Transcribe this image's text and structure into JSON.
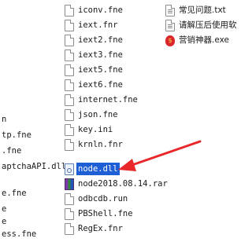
{
  "left_column": {
    "items": [
      {
        "label": "n"
      },
      {
        "label": "tp.fne"
      },
      {
        "label": ".fne"
      },
      {
        "label": "aptchaAPI.dll"
      },
      {
        "label": "e.fne"
      },
      {
        "label": "e"
      },
      {
        "label": "e"
      },
      {
        "label": "ess.fne"
      }
    ]
  },
  "middle_column": {
    "items": [
      {
        "label": "iconv.fne",
        "icon": "file-icon"
      },
      {
        "label": "iext.fnr",
        "icon": "file-icon"
      },
      {
        "label": "iext2.fne",
        "icon": "file-icon"
      },
      {
        "label": "iext3.fne",
        "icon": "file-icon"
      },
      {
        "label": "iext5.fne",
        "icon": "file-icon"
      },
      {
        "label": "iext6.fne",
        "icon": "file-icon"
      },
      {
        "label": "internet.fne",
        "icon": "file-icon"
      },
      {
        "label": "json.fne",
        "icon": "file-icon"
      },
      {
        "label": "key.ini",
        "icon": "file-icon"
      },
      {
        "label": "krnln.fnr",
        "icon": "file-icon"
      },
      {
        "label": "node.dll",
        "icon": "dll-icon",
        "selected": true
      },
      {
        "label": "node2018.08.14.rar",
        "icon": "rar-archive-icon"
      },
      {
        "label": "odbcdb.run",
        "icon": "file-icon"
      },
      {
        "label": "PBShell.fne",
        "icon": "file-icon"
      },
      {
        "label": "RegEx.fnr",
        "icon": "file-icon"
      }
    ]
  },
  "right_column": {
    "items": [
      {
        "label": "常见问题.txt",
        "icon": "text-file-icon"
      },
      {
        "label": "请解压后使用软",
        "icon": "text-file-icon"
      },
      {
        "label": "营销神器.exe",
        "icon": "money-bag-icon"
      }
    ]
  },
  "colors": {
    "selection": "#1f5fd6",
    "arrow": "#e8282b"
  }
}
